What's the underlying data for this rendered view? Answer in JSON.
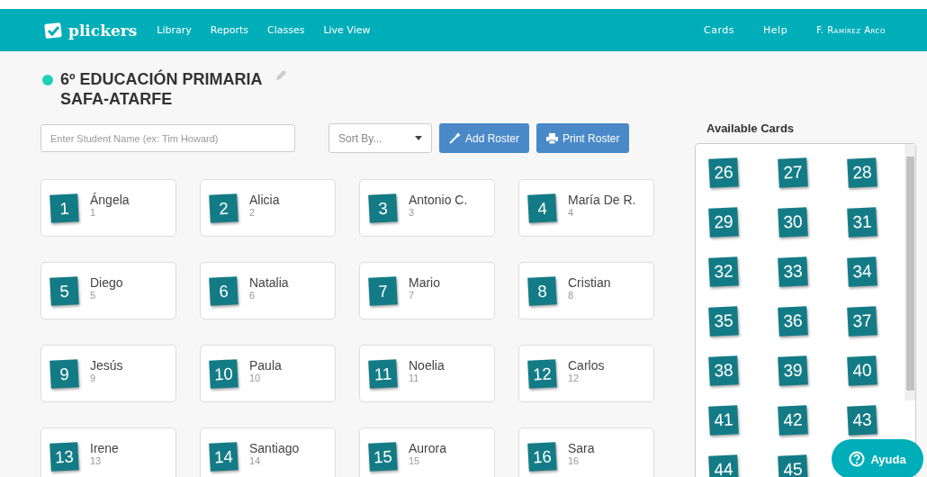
{
  "navbar": {
    "logo": "plickers",
    "links": [
      "Library",
      "Reports",
      "Classes",
      "Live View"
    ],
    "right_links": [
      "Cards",
      "Help"
    ],
    "user": "F. Ramírez Arco"
  },
  "class": {
    "title_lines": [
      "6º EDUCACIÓN PRIMARIA",
      "SAFA-ATARFE"
    ],
    "color": "#1ed1b8"
  },
  "search": {
    "placeholder": "Enter Student Name (ex: Tim Howard)"
  },
  "sort": {
    "placeholder": "Sort By..."
  },
  "buttons": [
    {
      "kind": "add",
      "label": "Add Roster"
    },
    {
      "kind": "print",
      "label": "Print Roster"
    }
  ],
  "students": [
    {
      "card": "1",
      "name": "Ángela",
      "number": "1"
    },
    {
      "card": "2",
      "name": "Alicia",
      "number": "2"
    },
    {
      "card": "3",
      "name": "Antonio C.",
      "number": "3"
    },
    {
      "card": "4",
      "name": "María De R.",
      "number": "4"
    },
    {
      "card": "5",
      "name": "Diego",
      "number": "5"
    },
    {
      "card": "6",
      "name": "Natalia",
      "number": "6"
    },
    {
      "card": "7",
      "name": "Mario",
      "number": "7"
    },
    {
      "card": "8",
      "name": "Cristian",
      "number": "8"
    },
    {
      "card": "9",
      "name": "Jesús",
      "number": "9"
    },
    {
      "card": "10",
      "name": "Paula",
      "number": "10"
    },
    {
      "card": "11",
      "name": "Noelia",
      "number": "11"
    },
    {
      "card": "12",
      "name": "Carlos",
      "number": "12"
    },
    {
      "card": "13",
      "name": "Irene",
      "number": "13"
    },
    {
      "card": "14",
      "name": "Santiago",
      "number": "14"
    },
    {
      "card": "15",
      "name": "Aurora",
      "number": "15"
    },
    {
      "card": "16",
      "name": "Sara",
      "number": "16"
    }
  ],
  "available_cards": {
    "title": "Available Cards",
    "cards": [
      "26",
      "27",
      "28",
      "29",
      "30",
      "31",
      "32",
      "33",
      "34",
      "35",
      "36",
      "37",
      "38",
      "39",
      "40",
      "41",
      "42",
      "43",
      "44",
      "45"
    ]
  },
  "help_button": {
    "label": "Ayuda"
  }
}
